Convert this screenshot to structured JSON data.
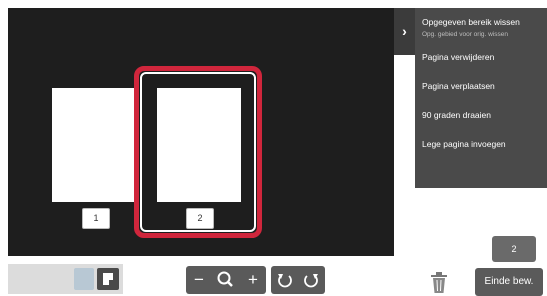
{
  "pages": [
    {
      "label": "1"
    },
    {
      "label": "2"
    }
  ],
  "menu": {
    "items": [
      {
        "label": "Opgegeven bereik wissen",
        "sublabel": "Opg. gebied voor orig. wissen"
      },
      {
        "label": "Pagina verwijderen"
      },
      {
        "label": "Pagina verplaatsen"
      },
      {
        "label": "90 graden draaien"
      },
      {
        "label": "Lege pagina invoegen"
      }
    ],
    "toggle_icon": "chevron-right-icon"
  },
  "page_count": "2",
  "toolbar": {
    "zoom_out": "−",
    "zoom_in": "+",
    "end_label": "Einde bew."
  },
  "colors": {
    "selection": "#d0263c",
    "viewer_bg": "#1e1e1e",
    "menu_bg": "#4a4a4a",
    "button_bg": "#5a5a5a"
  }
}
